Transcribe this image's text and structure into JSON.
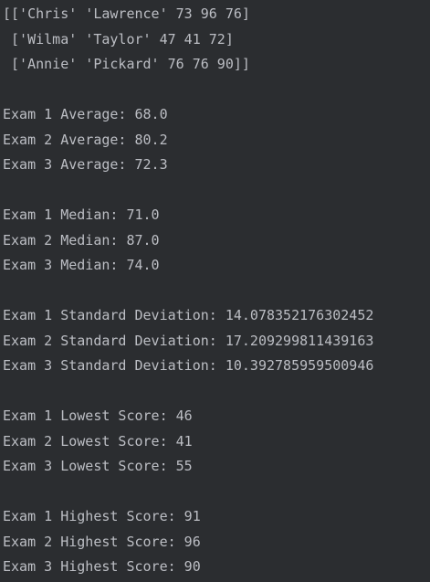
{
  "colors": {
    "background": "#2b2d30",
    "text": "#bcbec4"
  },
  "array_output": [
    "[['Chris' 'Lawrence' 73 96 76]",
    " ['Wilma' 'Taylor' 47 41 72]",
    " ['Annie' 'Pickard' 76 76 90]]"
  ],
  "averages": [
    "Exam 1 Average: 68.0",
    "Exam 2 Average: 80.2",
    "Exam 3 Average: 72.3"
  ],
  "medians": [
    "Exam 1 Median: 71.0",
    "Exam 2 Median: 87.0",
    "Exam 3 Median: 74.0"
  ],
  "std_devs": [
    "Exam 1 Standard Deviation: 14.078352176302452",
    "Exam 2 Standard Deviation: 17.209299811439163",
    "Exam 3 Standard Deviation: 10.392785959500946"
  ],
  "lowest": [
    "Exam 1 Lowest Score: 46",
    "Exam 2 Lowest Score: 41",
    "Exam 3 Lowest Score: 55"
  ],
  "highest": [
    "Exam 1 Highest Score: 91",
    "Exam 2 Highest Score: 96",
    "Exam 3 Highest Score: 90"
  ]
}
